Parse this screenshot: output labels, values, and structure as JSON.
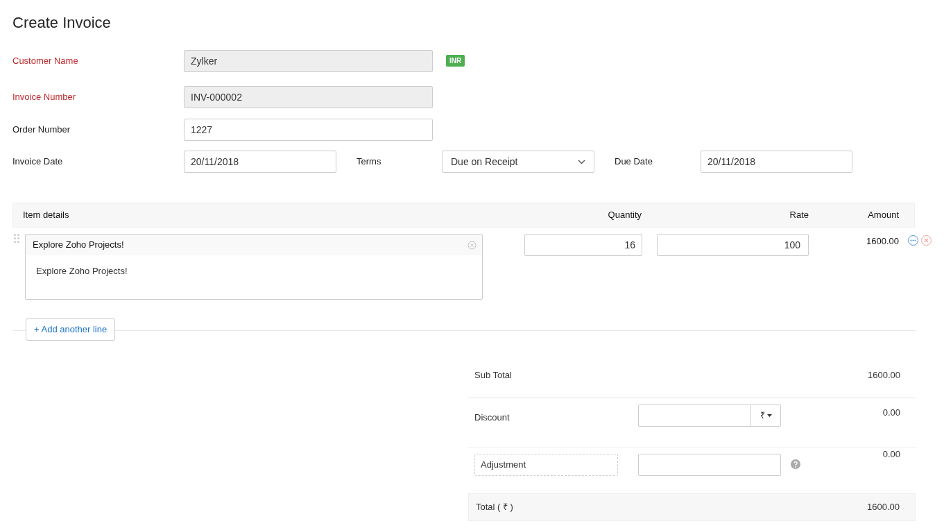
{
  "title": "Create Invoice",
  "fields": [
    {
      "label": "Customer Name",
      "value": "Zylker",
      "required": true,
      "readonly": true,
      "badge": "INR"
    },
    {
      "label": "Invoice Number",
      "value": "INV-000002",
      "required": true,
      "readonly": true
    },
    {
      "label": "Order Number",
      "value": "1227",
      "required": false,
      "readonly": false
    }
  ],
  "dates": {
    "invoice_date": {
      "label": "Invoice Date",
      "value": "20/11/2018"
    },
    "terms": {
      "label": "Terms",
      "value": "Due on Receipt"
    },
    "due_date": {
      "label": "Due Date",
      "value": "20/11/2018"
    }
  },
  "table": {
    "columns": [
      "Item details",
      "Quantity",
      "Rate",
      "Amount"
    ],
    "rows": [
      {
        "item_name": "Explore Zoho Projects!",
        "description": "Explore Zoho Projects!",
        "quantity": "16",
        "rate": "100",
        "amount": "1600.00"
      }
    ],
    "add_line": "+ Add another line"
  },
  "totals": {
    "sub_total": {
      "label": "Sub Total",
      "value": "1600.00"
    },
    "discount": {
      "label": "Discount",
      "unit": "₹",
      "value": "0.00"
    },
    "adjustment": {
      "label": "Adjustment",
      "value": "0.00"
    },
    "total": {
      "label": "Total ( ₹ )",
      "value": "1600.00"
    }
  }
}
